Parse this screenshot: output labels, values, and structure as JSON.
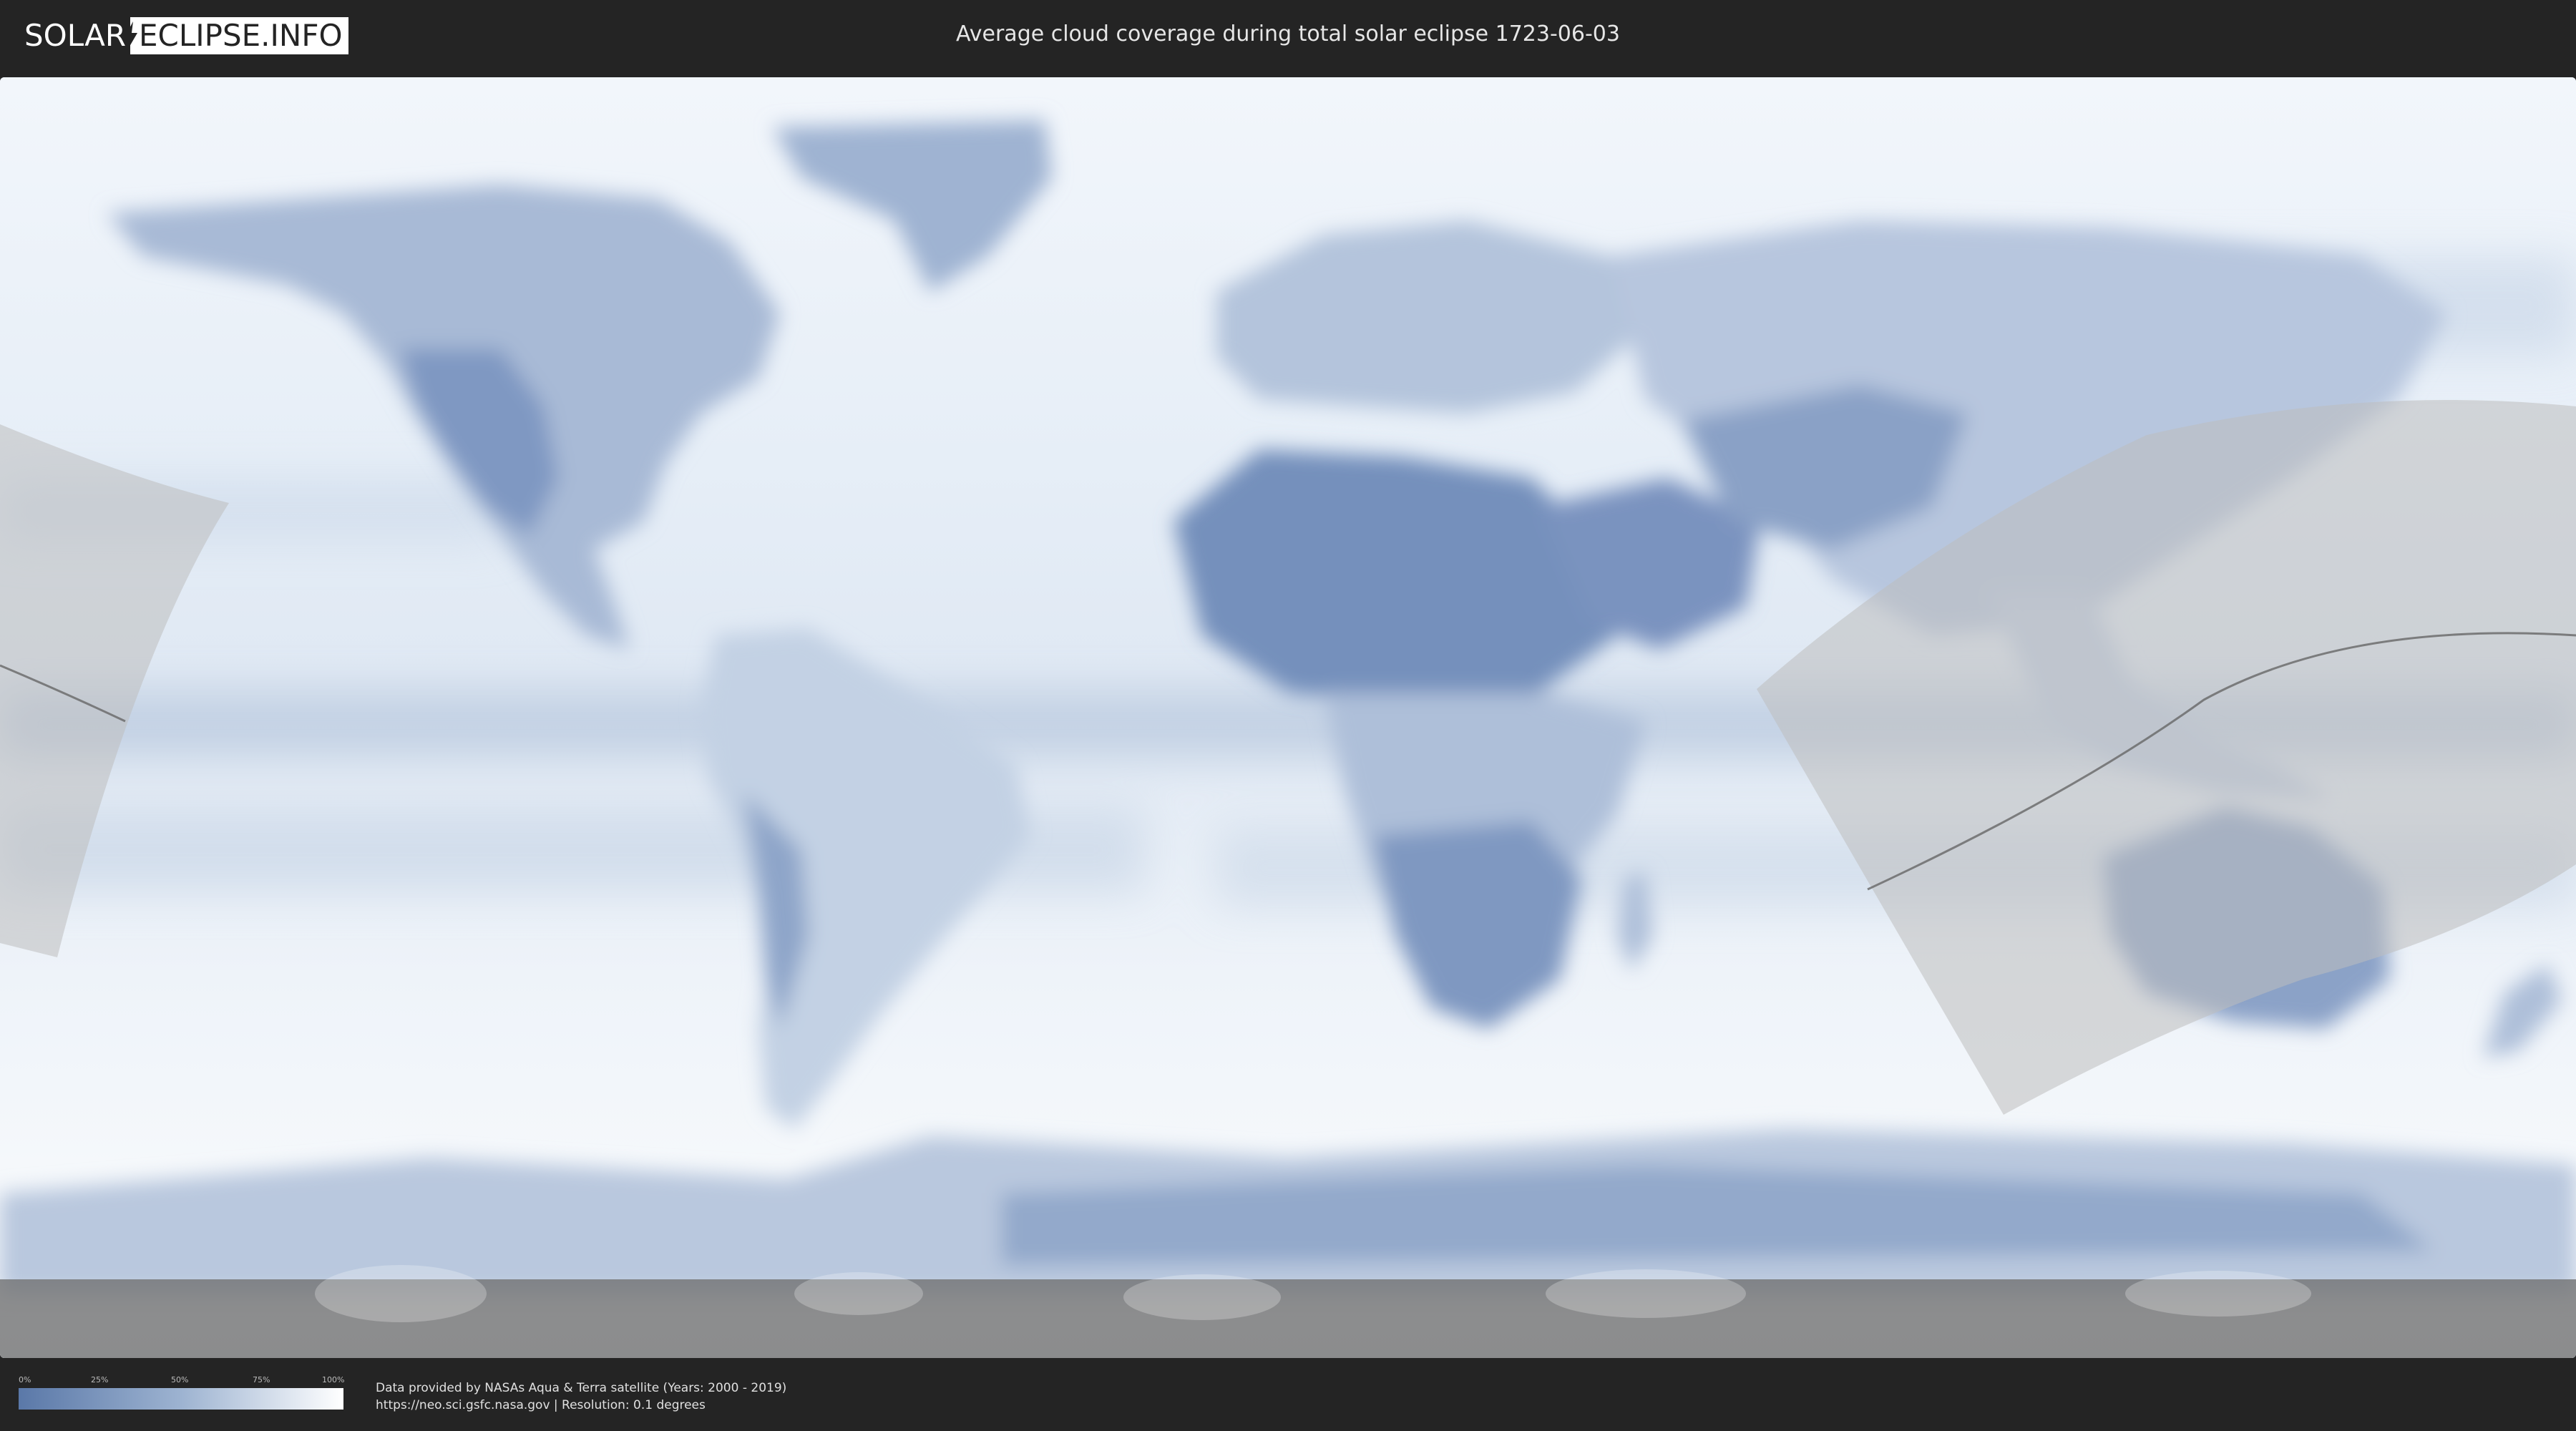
{
  "header": {
    "logo_part1": "SOLAR",
    "logo_part2": "ECLIPSE.INFO",
    "title": "Average cloud coverage during total solar eclipse 1723-06-03"
  },
  "legend": {
    "ticks": [
      "0%",
      "25%",
      "50%",
      "75%",
      "100%"
    ],
    "colors": {
      "low": "#5a78a8",
      "mid": "#9db3d1",
      "high": "#ffffff"
    }
  },
  "credits": {
    "line1": "Data provided by NASAs Aqua & Terra satellite (Years: 2000 - 2019)",
    "line2": "https://neo.sci.gsfc.nasa.gov | Resolution: 0.1 degrees"
  },
  "colors": {
    "background": "#242424",
    "cloud_clear": "#5a78a8",
    "cloud_full": "#ffffff",
    "eclipse_zone": "#c9c9c9",
    "central_line": "#666666"
  }
}
